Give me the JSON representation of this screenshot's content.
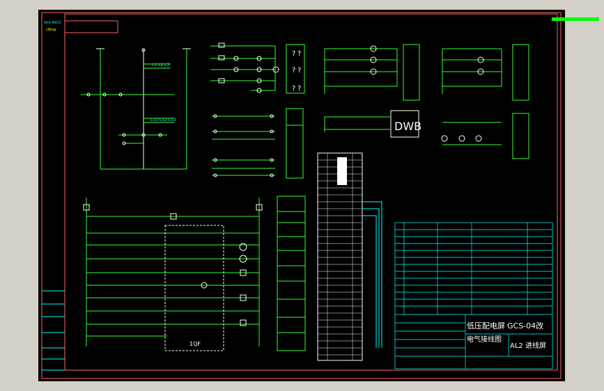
{
  "colors": {
    "background": "#000000",
    "viewport": "#d4d0c8",
    "frame": "#ff6666",
    "wire": "#33ff33",
    "device": "#ffffff",
    "label": "#ff3333",
    "table": "#00ffff",
    "accent": "#ffff00",
    "indicator": "#00ff00"
  },
  "title_block": {
    "title_line1": "低压配电屏",
    "drawing_no": "GCS-04改",
    "title_line2": "电气接线图",
    "subtitle": "AL2 进线屏"
  },
  "left_panel": {
    "top_code": "Sml-40CS",
    "top_sub": "cfbng"
  },
  "main_circuit": {
    "label_top": "L1 L2 L3",
    "label_mid": "L11 L12 L13"
  },
  "relay_panel": {
    "label": "1QF"
  },
  "indicator_box": {
    "label": "DWB"
  },
  "meters": {
    "unknown_mark": "?"
  }
}
